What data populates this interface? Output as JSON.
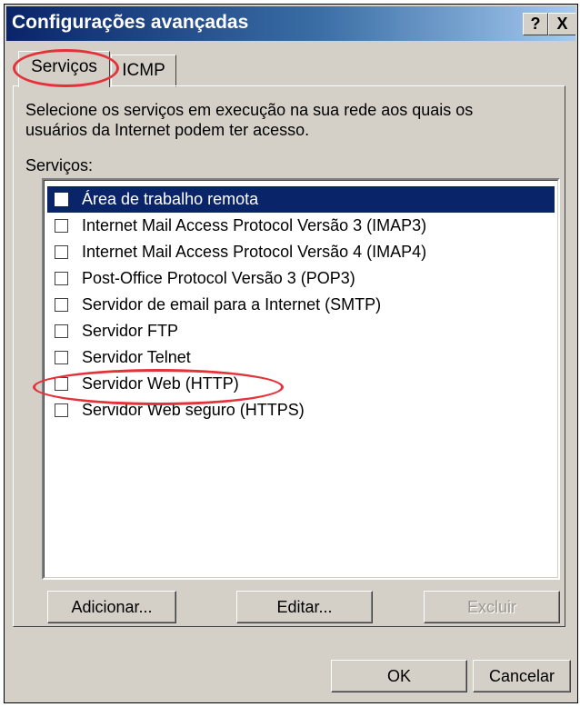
{
  "window": {
    "title": "Configurações avançadas",
    "help_label": "?",
    "close_label": "X"
  },
  "tabs": [
    {
      "label": "Serviços",
      "active": true
    },
    {
      "label": "ICMP",
      "active": false
    }
  ],
  "description": "Selecione os serviços em execução na sua rede aos quais os usuários da Internet podem ter acesso.",
  "services_label": "Serviços:",
  "services": [
    {
      "label": "Área de trabalho remota",
      "checked": false,
      "selected": true
    },
    {
      "label": "Internet Mail Access Protocol Versão 3 (IMAP3)",
      "checked": false
    },
    {
      "label": "Internet Mail Access Protocol Versão 4 (IMAP4)",
      "checked": false
    },
    {
      "label": "Post-Office Protocol Versão 3 (POP3)",
      "checked": false
    },
    {
      "label": "Servidor de email para a Internet (SMTP)",
      "checked": false
    },
    {
      "label": "Servidor FTP",
      "checked": false
    },
    {
      "label": "Servidor Telnet",
      "checked": false
    },
    {
      "label": "Servidor Web (HTTP)",
      "checked": false
    },
    {
      "label": "Servidor Web seguro (HTTPS)",
      "checked": false
    }
  ],
  "buttons": {
    "add": "Adicionar...",
    "edit": "Editar...",
    "delete": "Excluir",
    "ok": "OK",
    "cancel": "Cancelar"
  },
  "colors": {
    "title_gradient_start": "#0a246a",
    "selection": "#0a246a",
    "annotation": "#e4323a",
    "dialog_face": "#d4d0c8"
  }
}
